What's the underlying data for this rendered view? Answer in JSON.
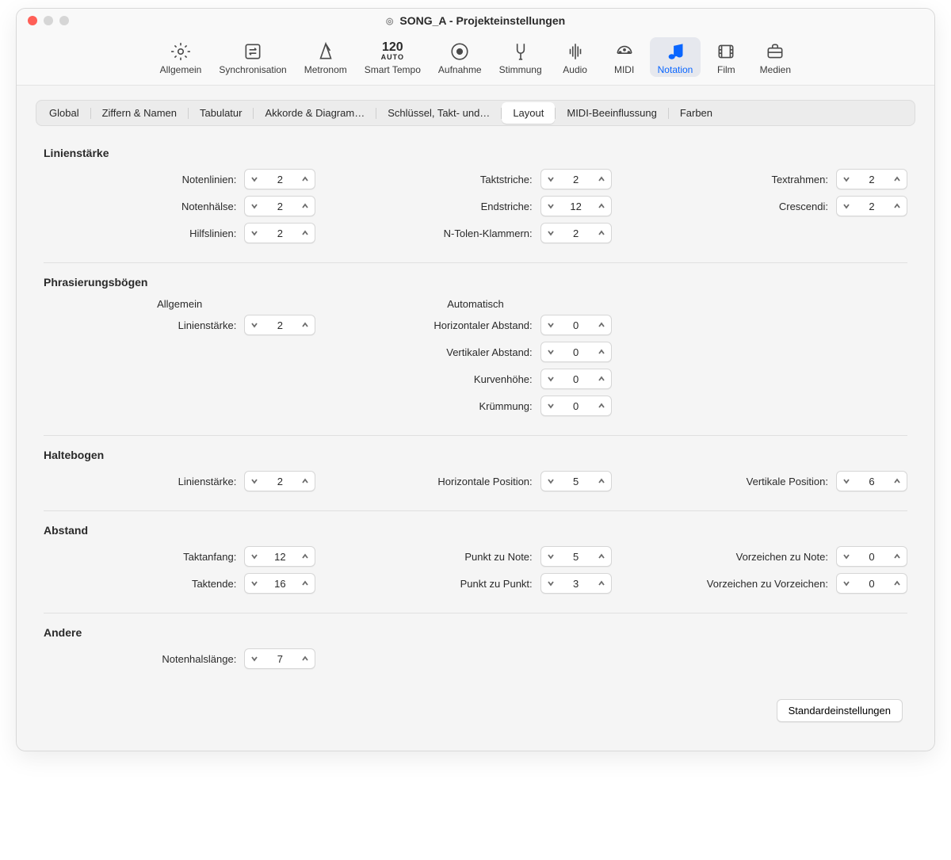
{
  "window": {
    "title": "SONG_A - Projekteinstellungen"
  },
  "toolbar": {
    "items": [
      {
        "id": "allgemein",
        "label": "Allgemein"
      },
      {
        "id": "synchronisation",
        "label": "Synchronisation"
      },
      {
        "id": "metronom",
        "label": "Metronom"
      },
      {
        "id": "smart-tempo",
        "label": "Smart Tempo",
        "textIcon": "120",
        "subIcon": "AUTO"
      },
      {
        "id": "aufnahme",
        "label": "Aufnahme"
      },
      {
        "id": "stimmung",
        "label": "Stimmung"
      },
      {
        "id": "audio",
        "label": "Audio"
      },
      {
        "id": "midi",
        "label": "MIDI"
      },
      {
        "id": "notation",
        "label": "Notation",
        "selected": true
      },
      {
        "id": "film",
        "label": "Film"
      },
      {
        "id": "medien",
        "label": "Medien"
      }
    ]
  },
  "tabs": [
    "Global",
    "Ziffern & Namen",
    "Tabulatur",
    "Akkorde & Diagram…",
    "Schlüssel, Takt- und…",
    "Layout",
    "MIDI-Beeinflussung",
    "Farben"
  ],
  "tabs_active_index": 5,
  "sections": {
    "linienstaerke": {
      "heading": "Linienstärke",
      "col1": [
        {
          "label": "Notenlinien:",
          "value": "2"
        },
        {
          "label": "Notenhälse:",
          "value": "2"
        },
        {
          "label": "Hilfslinien:",
          "value": "2"
        }
      ],
      "col2": [
        {
          "label": "Taktstriche:",
          "value": "2"
        },
        {
          "label": "Endstriche:",
          "value": "12"
        },
        {
          "label": "N-Tolen-Klammern:",
          "value": "2"
        }
      ],
      "col3": [
        {
          "label": "Textrahmen:",
          "value": "2"
        },
        {
          "label": "Crescendi:",
          "value": "2"
        }
      ]
    },
    "phrasierungsb": {
      "heading": "Phrasierungsbögen",
      "col1_head": "Allgemein",
      "col2_head": "Automatisch",
      "col1": [
        {
          "label": "Linienstärke:",
          "value": "2"
        }
      ],
      "col2": [
        {
          "label": "Horizontaler Abstand:",
          "value": "0"
        },
        {
          "label": "Vertikaler Abstand:",
          "value": "0"
        },
        {
          "label": "Kurvenhöhe:",
          "value": "0"
        },
        {
          "label": "Krümmung:",
          "value": "0"
        }
      ]
    },
    "haltebogen": {
      "heading": "Haltebogen",
      "col1": [
        {
          "label": "Linienstärke:",
          "value": "2"
        }
      ],
      "col2": [
        {
          "label": "Horizontale Position:",
          "value": "5"
        }
      ],
      "col3": [
        {
          "label": "Vertikale Position:",
          "value": "6"
        }
      ]
    },
    "abstand": {
      "heading": "Abstand",
      "col1": [
        {
          "label": "Taktanfang:",
          "value": "12"
        },
        {
          "label": "Taktende:",
          "value": "16"
        }
      ],
      "col2": [
        {
          "label": "Punkt zu Note:",
          "value": "5"
        },
        {
          "label": "Punkt zu Punkt:",
          "value": "3"
        }
      ],
      "col3": [
        {
          "label": "Vorzeichen zu Note:",
          "value": "0"
        },
        {
          "label": "Vorzeichen zu Vorzeichen:",
          "value": "0"
        }
      ]
    },
    "andere": {
      "heading": "Andere",
      "col1": [
        {
          "label": "Notenhalslänge:",
          "value": "7"
        }
      ]
    }
  },
  "footer": {
    "defaults_button": "Standardeinstellungen"
  }
}
